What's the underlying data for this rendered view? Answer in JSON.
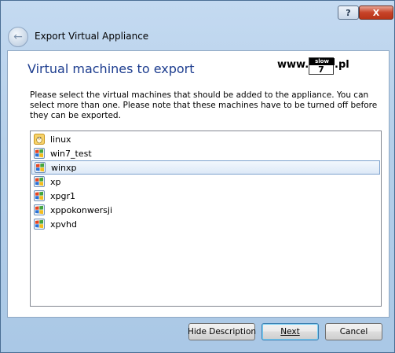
{
  "window": {
    "help_label": "?",
    "close_label": "X"
  },
  "header": {
    "back_glyph": "←",
    "title": "Export Virtual Appliance"
  },
  "page": {
    "heading": "Virtual machines to export",
    "description": "Please select the virtual machines that should be added to the appliance. You can select more than one. Please note that these machines have to be turned off before they can be exported."
  },
  "watermark": {
    "left_text": "www.",
    "box_label": "slow",
    "box_number": "7",
    "right_text": ".pl"
  },
  "vm_list": {
    "items": [
      {
        "label": "linux",
        "icon": "linux-os-icon"
      },
      {
        "label": "win7_test",
        "icon": "windows-os-icon"
      },
      {
        "label": "winxp",
        "icon": "windows-os-icon",
        "selected": true
      },
      {
        "label": "xp",
        "icon": "windows-os-icon"
      },
      {
        "label": "xpgr1",
        "icon": "windows-os-icon"
      },
      {
        "label": "xppokonwersji",
        "icon": "windows-os-icon"
      },
      {
        "label": "xpvhd",
        "icon": "windows-os-icon"
      }
    ]
  },
  "buttons": {
    "hide_description": "Hide Description",
    "next": "Next",
    "cancel": "Cancel"
  },
  "colors": {
    "heading": "#1d3d8f",
    "selection_border": "#7da2ce",
    "frame": "#b5cfe9"
  }
}
